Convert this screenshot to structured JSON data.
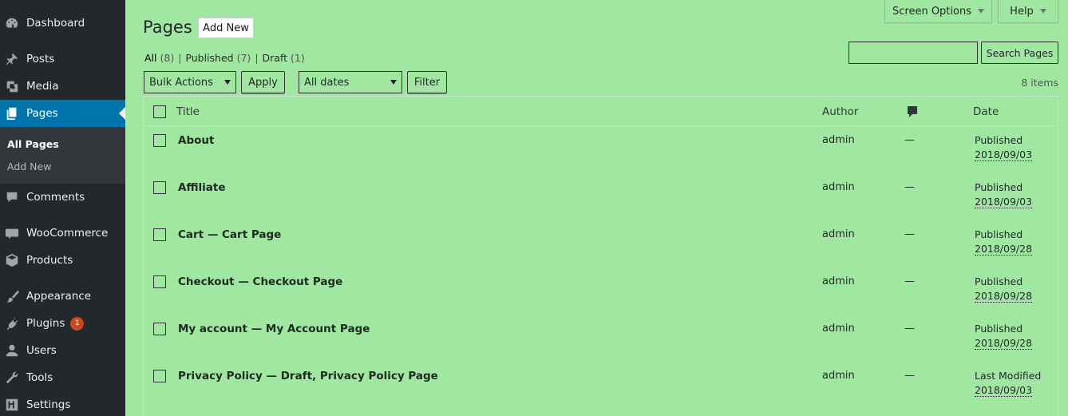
{
  "sidebar": {
    "items": [
      {
        "label": "Dashboard",
        "icon": "dashboard-icon"
      },
      {
        "label": "Posts",
        "icon": "pin-icon"
      },
      {
        "label": "Media",
        "icon": "media-icon"
      },
      {
        "label": "Pages",
        "icon": "pages-icon"
      },
      {
        "label": "Comments",
        "icon": "comment-icon"
      },
      {
        "label": "WooCommerce",
        "icon": "woo-icon"
      },
      {
        "label": "Products",
        "icon": "box-icon"
      },
      {
        "label": "Appearance",
        "icon": "brush-icon"
      },
      {
        "label": "Plugins",
        "icon": "plug-icon",
        "badge": "1"
      },
      {
        "label": "Users",
        "icon": "user-icon"
      },
      {
        "label": "Tools",
        "icon": "wrench-icon"
      },
      {
        "label": "Settings",
        "icon": "settings-icon"
      }
    ],
    "submenu": [
      "All Pages",
      "Add New"
    ]
  },
  "top_tabs": {
    "screen_options": "Screen Options",
    "help": "Help"
  },
  "heading": {
    "title": "Pages",
    "add_new": "Add New"
  },
  "views": {
    "all": "All",
    "all_count": "(8)",
    "published": "Published",
    "published_count": "(7)",
    "draft": "Draft",
    "draft_count": "(1)",
    "separator": "|"
  },
  "search": {
    "value": "",
    "button": "Search Pages"
  },
  "tablenav": {
    "bulk_actions": "Bulk Actions",
    "apply": "Apply",
    "dates": "All dates",
    "filter": "Filter",
    "items_count": "8 items"
  },
  "table": {
    "headers": {
      "title": "Title",
      "author": "Author",
      "date": "Date"
    },
    "rows": [
      {
        "title": "About",
        "author": "admin",
        "comments": "—",
        "status": "Published",
        "date": "2018/09/03"
      },
      {
        "title": "Affiliate",
        "author": "admin",
        "comments": "—",
        "status": "Published",
        "date": "2018/09/03"
      },
      {
        "title": "Cart — Cart Page",
        "author": "admin",
        "comments": "—",
        "status": "Published",
        "date": "2018/09/28"
      },
      {
        "title": "Checkout — Checkout Page",
        "author": "admin",
        "comments": "—",
        "status": "Published",
        "date": "2018/09/28"
      },
      {
        "title": "My account — My Account Page",
        "author": "admin",
        "comments": "—",
        "status": "Published",
        "date": "2018/09/28"
      },
      {
        "title": "Privacy Policy — Draft, Privacy Policy Page",
        "author": "admin",
        "comments": "—",
        "status": "Last Modified",
        "date": "2018/09/03"
      }
    ]
  },
  "colors": {
    "sidebar": "#23282d",
    "active": "#0073aa",
    "background": "#a0e8a2",
    "badge": "#ca4a1f"
  }
}
